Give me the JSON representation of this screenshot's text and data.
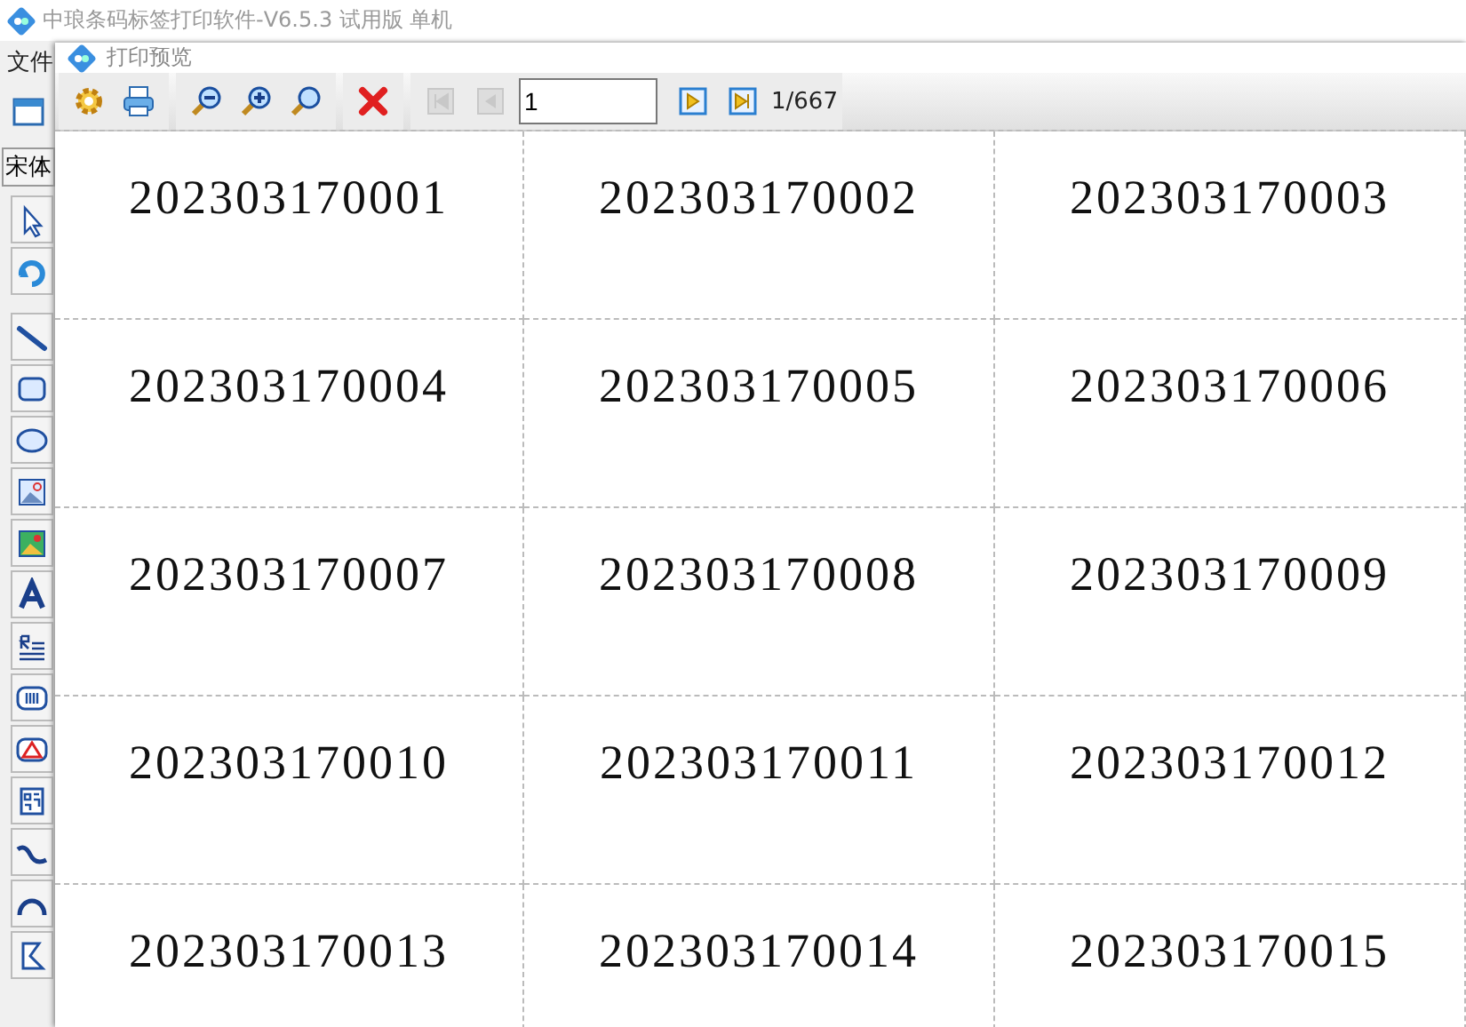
{
  "main_window": {
    "title": "中琅条码标签打印软件-V6.5.3 试用版 单机",
    "menu": [
      "文件"
    ],
    "font_field": {
      "value": "宋体"
    }
  },
  "preview_window": {
    "title": "打印预览",
    "nav_buttons": [
      {
        "kind": "first",
        "disabled": true
      },
      {
        "kind": "prev",
        "disabled": true
      },
      {
        "kind": "next",
        "disabled": false
      },
      {
        "kind": "last",
        "disabled": false
      }
    ],
    "page_field": {
      "value": "1"
    },
    "page_count": "1/667",
    "labels": [
      "202303170001",
      "202303170002",
      "202303170003",
      "202303170004",
      "202303170005",
      "202303170006",
      "202303170007",
      "202303170008",
      "202303170009",
      "202303170010",
      "202303170011",
      "202303170012",
      "202303170013",
      "202303170014",
      "202303170015"
    ]
  }
}
